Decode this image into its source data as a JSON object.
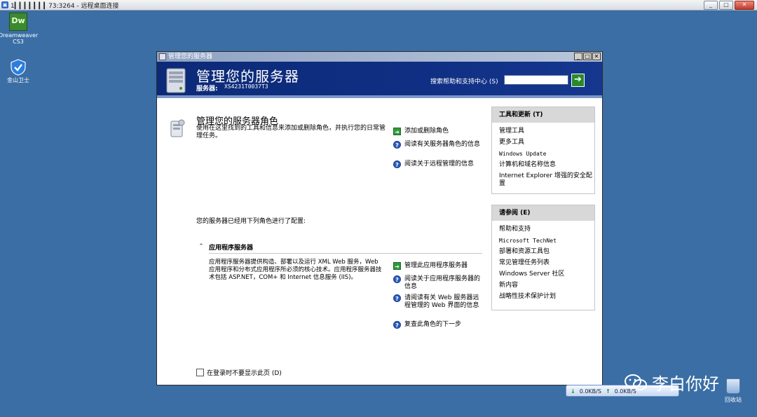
{
  "rdp": {
    "title": "1▎▎▎▎▎▎▎73:3264 - 远程桌面连接",
    "min": "_",
    "max": "□",
    "close": "✕"
  },
  "desktop": {
    "icons": [
      {
        "label": "Dreamweaver CS3",
        "glyph": "Dw"
      },
      {
        "label": "金山卫士"
      }
    ]
  },
  "window": {
    "title": "管理您的服务器",
    "buttons": {
      "min": "_",
      "max": "□",
      "close": "✕"
    },
    "banner": {
      "title": "管理您的服务器",
      "server_label": "服务器:",
      "server_value": "XS4231T0037T3",
      "search_label": "搜索帮助和支持中心 (S)",
      "search_value": "",
      "go": "➔"
    },
    "roles": {
      "heading": "管理您的服务器角色",
      "description": "使用在这里找到的工具和信息来添加或删除角色，并执行您的日常管理任务。",
      "actions": [
        {
          "icon": "arrow",
          "label": "添加或删除角色"
        },
        {
          "icon": "help",
          "label": "阅读有关服务器角色的信息"
        },
        {
          "icon": "help",
          "label": "阅读关于远程管理的信息"
        }
      ],
      "configured": "您的服务器已经用下列角色进行了配置:"
    },
    "app_server": {
      "toggle": "⌃",
      "title": "应用程序服务器",
      "description": "应用程序服务器提供构造、部署以及运行 XML Web 服务，Web 应用程序和分布式应用程序所必须的核心技术。应用程序服务器技术包括 ASP.NET，COM+ 和 Internet 信息服务 (IIS)。",
      "actions": [
        {
          "icon": "arrow",
          "label": "管理此应用程序服务器"
        },
        {
          "icon": "help",
          "label": "阅读关于应用程序服务器的信息"
        },
        {
          "icon": "help",
          "label": "请阅读有关 Web 服务器远程管理的 Web 界面的信息"
        },
        {
          "icon": "help",
          "label": "复查此角色的下一步"
        }
      ]
    },
    "dont_show": "在登录时不要显示此页 (D)",
    "tools_panel": {
      "title": "工具和更新 (T)",
      "items": [
        "管理工具",
        "更多工具",
        "Windows Update",
        "计算机和域名称信息",
        "Internet Explorer 增强的安全配置"
      ]
    },
    "see_also_panel": {
      "title": "请参阅 (E)",
      "items": [
        "帮助和支持",
        "Microsoft TechNet",
        "部署和资源工具包",
        "常见管理任务列表",
        "Windows Server 社区",
        "新内容",
        "战略性技术保护计划"
      ]
    }
  },
  "taskbar": {
    "down_arrow": "↓",
    "down_speed": "0.0KB/S",
    "up_arrow": "↑",
    "up_speed": "0.0KB/S"
  },
  "watermark": {
    "text": "李白你好"
  },
  "recycle_bin": {
    "label": "回收站"
  },
  "colors": {
    "desktop": "#3a6ea5",
    "banner": "#0c2a78",
    "panel_header": "#d8d8d8",
    "arrow_icon": "#2f9a3a",
    "help_icon": "#2a5dbf"
  }
}
